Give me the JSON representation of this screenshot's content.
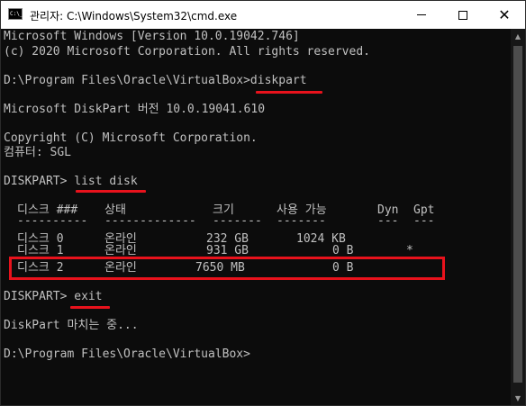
{
  "window": {
    "title": "관리자: C:\\Windows\\System32\\cmd.exe",
    "icon_text": "C:\\_",
    "minimize_icon": "minimize-icon",
    "maximize_icon": "maximize-icon",
    "close_glyph": "✕"
  },
  "console": {
    "lines": [
      "Microsoft Windows [Version 10.0.19042.746]",
      "(c) 2020 Microsoft Corporation. All rights reserved.",
      "D:\\Program Files\\Oracle\\VirtualBox>diskpart",
      "Microsoft DiskPart 버전 10.0.19041.610",
      "Copyright (C) Microsoft Corporation.",
      "컴퓨터: SGL",
      "DISKPART> list disk",
      "DISKPART> exit",
      "DiskPart 마치는 중...",
      "D:\\Program Files\\Oracle\\VirtualBox>"
    ],
    "disk_table": {
      "headers": [
        "디스크 ###",
        "상태",
        "크기",
        "사용 가능",
        "Dyn",
        "Gpt"
      ],
      "separators": [
        "----------",
        "-------------",
        "-------",
        "-------",
        "---",
        "---"
      ],
      "rows": [
        [
          "디스크 0",
          "온라인",
          "232 GB",
          "1024 KB",
          "",
          ""
        ],
        [
          "디스크 1",
          "온라인",
          "931 GB",
          "0 B",
          "",
          "*"
        ],
        [
          "디스크 2",
          "온라인",
          "7650 MB",
          "0 B",
          "",
          ""
        ]
      ]
    }
  },
  "annotations": {
    "color": "#e8121c"
  }
}
